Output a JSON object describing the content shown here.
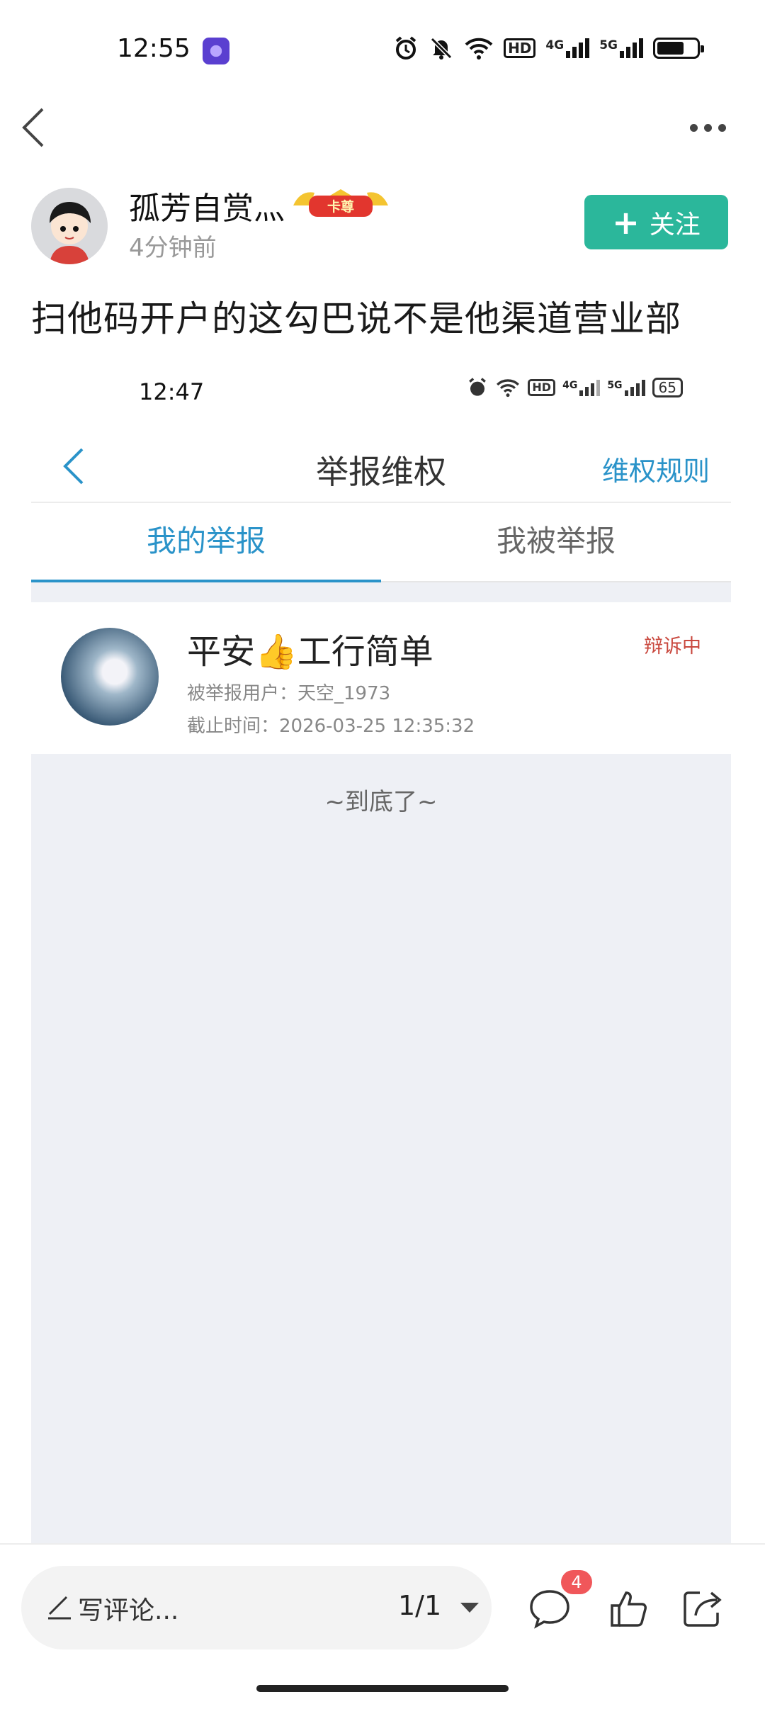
{
  "status_bar": {
    "time": "12:55",
    "net_4g": "4G",
    "net_5g": "5G",
    "hd": "HD"
  },
  "nav": {
    "back_icon": "chevron-left-icon",
    "more_icon": "more-dots-icon"
  },
  "author": {
    "name": "孤芳自赏灬",
    "badge": "卡尊",
    "time_ago": "4分钟前",
    "follow_label": "关注",
    "follow_icon": "+"
  },
  "post": {
    "text": "扫他码开户的这勾巴说不是他渠道营业部"
  },
  "embedded": {
    "status_time": "12:47",
    "status_4g": "4G",
    "status_5g": "5G",
    "status_hd": "HD",
    "battery": "65",
    "title": "举报维权",
    "rules_link": "维权规则",
    "tabs": [
      {
        "label": "我的举报",
        "active": true
      },
      {
        "label": "我被举报",
        "active": false
      }
    ],
    "report": {
      "name": "平安👍工行简单",
      "reported_user": "被举报用户：天空_1973",
      "deadline": "截止时间：2026-03-25 12:35:32",
      "status": "辩诉中"
    },
    "end_text": "~到底了~"
  },
  "bottom_bar": {
    "comment_placeholder": "写评论...",
    "page_indicator": "1/1",
    "comment_count": "4"
  },
  "colors": {
    "accent_green": "#2bb79b",
    "link_blue": "#2a93c9",
    "status_red": "#c9483e",
    "badge_red": "#f0575a"
  }
}
